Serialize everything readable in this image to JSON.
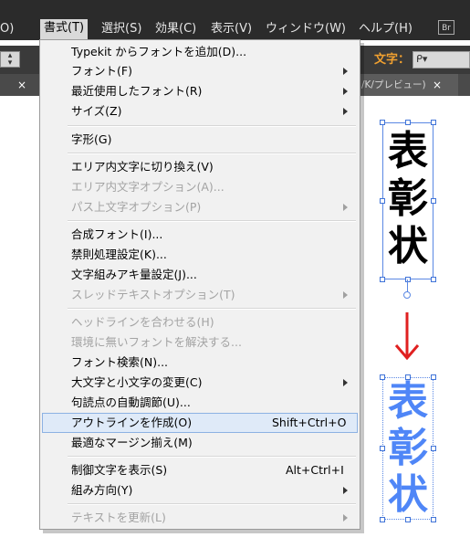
{
  "menubar": {
    "items": [
      {
        "label": "O)"
      },
      {
        "label": "書式(T)"
      },
      {
        "label": "選択(S)"
      },
      {
        "label": "効果(C)"
      },
      {
        "label": "表示(V)"
      },
      {
        "label": "ウィンドウ(W)"
      },
      {
        "label": "ヘルプ(H)"
      }
    ],
    "br_label": "Br"
  },
  "control_panel": {
    "char_label": "文字：",
    "font_field_value": "ᑭ▾"
  },
  "tabs": {
    "left_close": "×",
    "right_label": "/K/プレビュー)",
    "right_close": "×"
  },
  "type_menu": {
    "items": [
      {
        "label": "Typekit からフォントを追加(D)..."
      },
      {
        "label": "フォント(F)"
      },
      {
        "label": "最近使用したフォント(R)"
      },
      {
        "label": "サイズ(Z)"
      },
      {
        "label": "字形(G)"
      },
      {
        "label": "エリア内文字に切り換え(V)"
      },
      {
        "label": "エリア内文字オプション(A)..."
      },
      {
        "label": "パス上文字オプション(P)"
      },
      {
        "label": "合成フォント(I)..."
      },
      {
        "label": "禁則処理設定(K)..."
      },
      {
        "label": "文字組みアキ量設定(J)..."
      },
      {
        "label": "スレッドテキストオプション(T)"
      },
      {
        "label": "ヘッドラインを合わせる(H)"
      },
      {
        "label": "環境に無いフォントを解決する..."
      },
      {
        "label": "フォント検索(N)..."
      },
      {
        "label": "大文字と小文字の変更(C)"
      },
      {
        "label": "句読点の自動調節(U)..."
      },
      {
        "label": "アウトラインを作成(O)",
        "shortcut": "Shift+Ctrl+O"
      },
      {
        "label": "最適なマージン揃え(M)"
      },
      {
        "label": "制御文字を表示(S)",
        "shortcut": "Alt+Ctrl+I"
      },
      {
        "label": "組み方向(Y)"
      },
      {
        "label": "テキストを更新(L)"
      }
    ]
  },
  "artwork": {
    "text_before": [
      "表",
      "彰",
      "状"
    ],
    "text_after": [
      "表",
      "彰",
      "状"
    ],
    "arrow_color": "#e02020",
    "outline_color": "#4f86f7"
  }
}
